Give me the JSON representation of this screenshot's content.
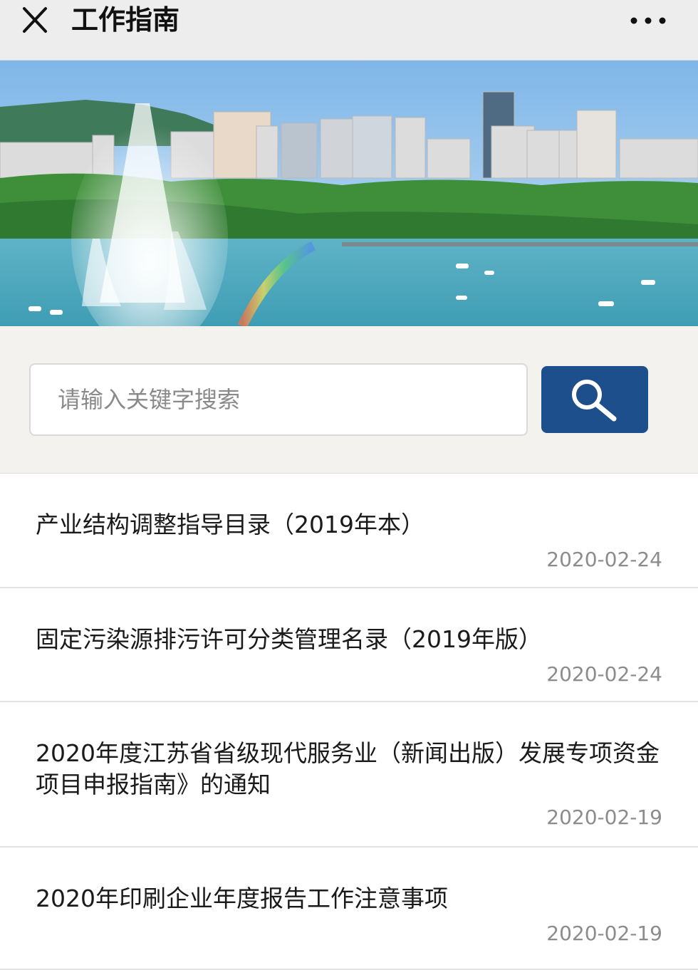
{
  "header": {
    "title": "工作指南",
    "close_icon": "close-icon",
    "more_icon": "more-dots-icon"
  },
  "banner": {
    "description_icon": "city-lake-fountain-photo"
  },
  "search": {
    "placeholder": "请输入关键字搜索",
    "button_icon": "search-icon",
    "button_color": "#1d4f8c"
  },
  "articles": [
    {
      "title": "产业结构调整指导目录（2019年本）",
      "date": "2020-02-24"
    },
    {
      "title": "固定污染源排污许可分类管理名录（2019年版）",
      "date": "2020-02-24"
    },
    {
      "title": "2020年度江苏省省级现代服务业（新闻出版）发展专项资金项目申报指南》的通知",
      "date": "2020-02-19"
    },
    {
      "title": "2020年印刷企业年度报告工作注意事项",
      "date": "2020-02-19"
    }
  ]
}
